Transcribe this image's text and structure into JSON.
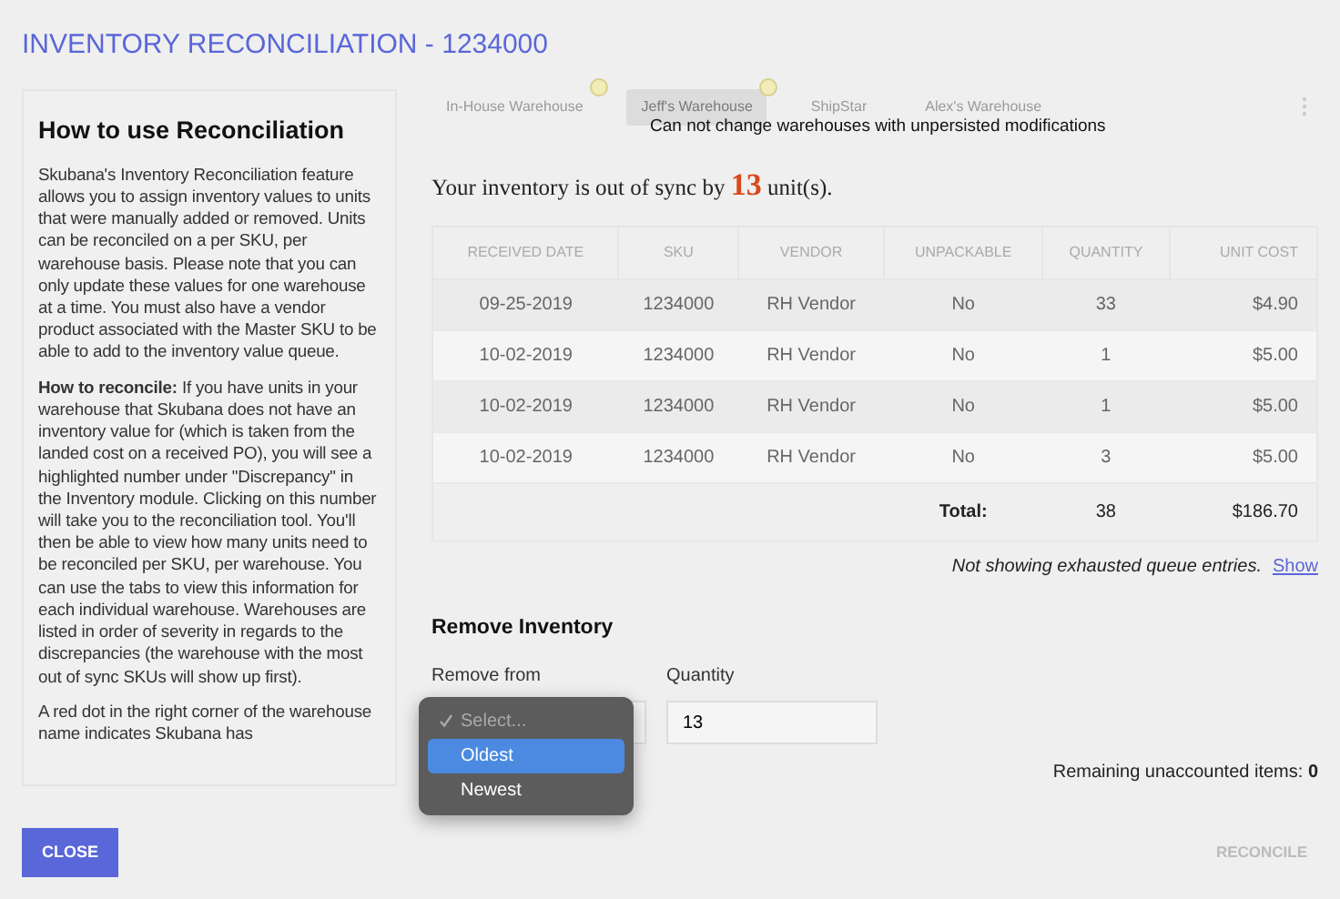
{
  "title": "INVENTORY RECONCILIATION - 1234000",
  "help": {
    "heading": "How to use Reconciliation",
    "paragraphs": [
      "Skubana's Inventory Reconciliation feature allows you to assign inventory values to units that were manually added or removed. Units can be reconciled on a per SKU, per warehouse basis. Please note that you can only update these values for one warehouse at a time. You must also have a vendor product associated with the Master SKU to be able to add to the inventory value queue.",
      "**How to reconcile:** If you have units in your warehouse that Skubana does not have an inventory value for (which is taken from the landed cost on a received PO), you will see a highlighted number under \"Discrepancy\" in the Inventory module. Clicking on this number will take you to the reconciliation tool. You'll then be able to view how many units need to be reconciled per SKU, per warehouse. You can use the tabs to view this information for each individual warehouse. Warehouses are listed in order of severity in regards to the discrepancies (the warehouse with the most out of sync SKUs will show up first).",
      "A red dot in the right corner of the warehouse name indicates Skubana has"
    ]
  },
  "tabs": [
    {
      "label": "In-House Warehouse",
      "selected": false,
      "dot": true
    },
    {
      "label": "Jeff's Warehouse",
      "selected": true,
      "dot": true
    },
    {
      "label": "ShipStar",
      "selected": false,
      "dot": false
    },
    {
      "label": "Alex's Warehouse",
      "selected": false,
      "dot": false
    }
  ],
  "tabs_disabled": true,
  "tooltip": "Can not change warehouses with unpersisted modifications",
  "sync": {
    "prefix": "Your inventory is out of sync by",
    "count": "13",
    "suffix": "unit(s)."
  },
  "table": {
    "columns": [
      "RECEIVED DATE",
      "SKU",
      "VENDOR",
      "UNPACKABLE",
      "QUANTITY",
      "UNIT COST"
    ],
    "rows": [
      [
        "09-25-2019",
        "1234000",
        "RH Vendor",
        "No",
        "33",
        "$4.90"
      ],
      [
        "10-02-2019",
        "1234000",
        "RH Vendor",
        "No",
        "1",
        "$5.00"
      ],
      [
        "10-02-2019",
        "1234000",
        "RH Vendor",
        "No",
        "1",
        "$5.00"
      ],
      [
        "10-02-2019",
        "1234000",
        "RH Vendor",
        "No",
        "3",
        "$5.00"
      ]
    ],
    "total": {
      "label": "Total:",
      "quantity": "38",
      "cost": "$186.70"
    }
  },
  "queue_note": {
    "text": "Not showing exhausted queue entries.",
    "link": "Show"
  },
  "remove": {
    "heading": "Remove Inventory",
    "remove_from": {
      "label": "Remove from",
      "menu": [
        {
          "label": "Select...",
          "checked": true,
          "highlighted": false
        },
        {
          "label": "Oldest",
          "checked": false,
          "highlighted": true
        },
        {
          "label": "Newest",
          "checked": false,
          "highlighted": false
        }
      ]
    },
    "quantity": {
      "label": "Quantity",
      "value": "13"
    }
  },
  "remaining": {
    "label": "Remaining unaccounted items:",
    "value": "0"
  },
  "buttons": {
    "close": "CLOSE",
    "reconcile": {
      "label": "RECONCILE",
      "disabled": true
    }
  }
}
